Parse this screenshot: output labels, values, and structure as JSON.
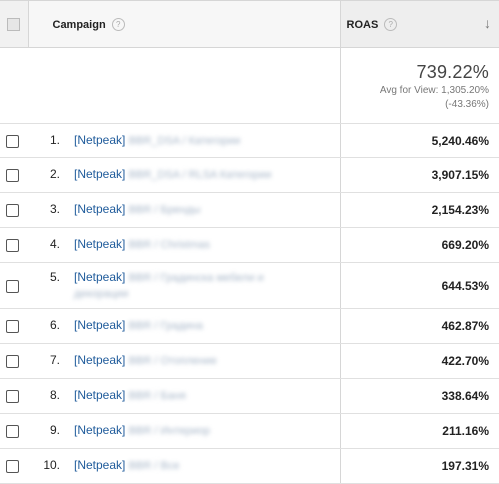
{
  "header": {
    "campaign_label": "Campaign",
    "roas_label": "ROAS",
    "help_glyph": "?",
    "sort_glyph": "🡣"
  },
  "summary": {
    "value": "739.22%",
    "avg_line1": "Avg for View: 1,305.20%",
    "avg_line2": "(-43.36%)"
  },
  "rows": [
    {
      "index": "1.",
      "prefix": "[Netpeak]",
      "rest": "BBR_DSA / Категории",
      "roas": "5,240.46%"
    },
    {
      "index": "2.",
      "prefix": "[Netpeak]",
      "rest": "BBR_DSA / RLSA Категории",
      "roas": "3,907.15%"
    },
    {
      "index": "3.",
      "prefix": "[Netpeak]",
      "rest": "BBR / Бренды",
      "roas": "2,154.23%"
    },
    {
      "index": "4.",
      "prefix": "[Netpeak]",
      "rest": "BBR / Christmas",
      "roas": "669.20%"
    },
    {
      "index": "5.",
      "prefix": "[Netpeak]",
      "rest": "BBR / Градинска мебели и декорации",
      "roas": "644.53%"
    },
    {
      "index": "6.",
      "prefix": "[Netpeak]",
      "rest": "BBR / Градина",
      "roas": "462.87%"
    },
    {
      "index": "7.",
      "prefix": "[Netpeak]",
      "rest": "BBR / Отопление",
      "roas": "422.70%"
    },
    {
      "index": "8.",
      "prefix": "[Netpeak]",
      "rest": "BBR / Баня",
      "roas": "338.64%"
    },
    {
      "index": "9.",
      "prefix": "[Netpeak]",
      "rest": "BBR / Интериор",
      "roas": "211.16%"
    },
    {
      "index": "10.",
      "prefix": "[Netpeak]",
      "rest": "BBR / Всe",
      "roas": "197.31%"
    }
  ]
}
